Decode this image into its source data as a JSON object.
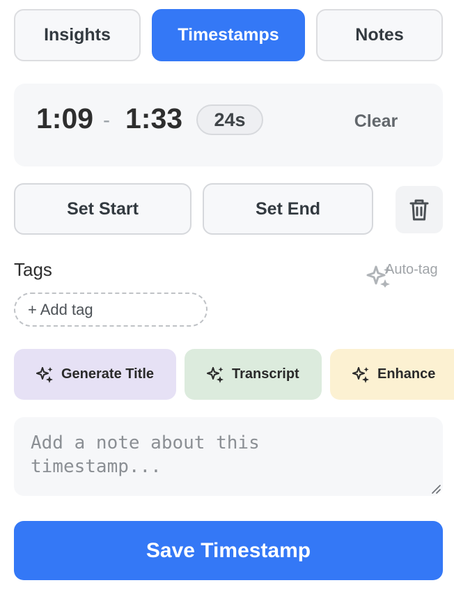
{
  "tabs": [
    {
      "label": "Insights",
      "active": false
    },
    {
      "label": "Timestamps",
      "active": true
    },
    {
      "label": "Notes",
      "active": false
    }
  ],
  "range": {
    "start": "1:09",
    "separator": "-",
    "end": "1:33",
    "duration": "24s",
    "clear_label": "Clear"
  },
  "actions": {
    "set_start_label": "Set Start",
    "set_end_label": "Set End",
    "delete_icon": "trash-icon"
  },
  "tags": {
    "label": "Tags",
    "autotag_label": "Auto-tag",
    "add_tag_label": "+ Add tag"
  },
  "ai_actions": [
    {
      "label": "Generate Title",
      "icon": "sparkles-icon",
      "color": "#e6e1f5"
    },
    {
      "label": "Transcript",
      "icon": "sparkles-icon",
      "color": "#dcebdd"
    },
    {
      "label": "Enhance",
      "icon": "sparkles-icon",
      "color": "#fcf1d2"
    }
  ],
  "note": {
    "placeholder": "Add a note about this timestamp..."
  },
  "save_label": "Save Timestamp",
  "colors": {
    "accent": "#3478f6",
    "card_bg": "#f6f7f9"
  }
}
